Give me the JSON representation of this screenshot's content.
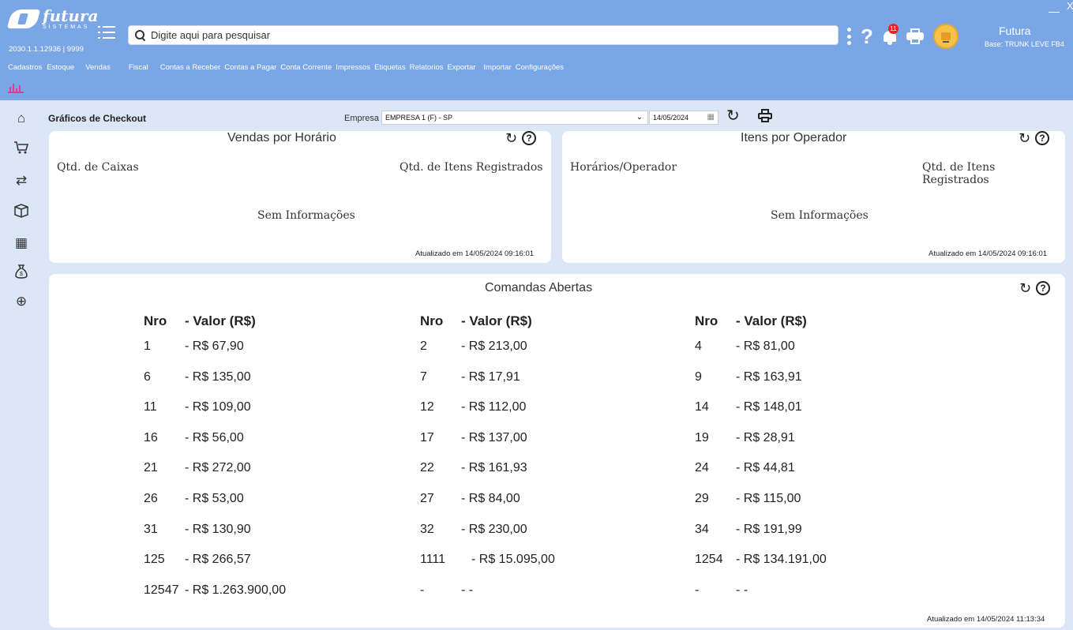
{
  "app": {
    "logo_brand": "futura",
    "logo_sub": "SISTEMAS",
    "version": "2030.1.1.12936 | 9999",
    "search_placeholder": "Digite aqui para pesquisar",
    "notification_count": "11",
    "user_name": "Futura",
    "user_base": "Base: TRUNK LEVE FB4",
    "window_min": "—",
    "window_close": "X"
  },
  "nav": [
    "Cadastros",
    "Estoque",
    "Vendas",
    "Fiscal",
    "Contas a Receber",
    "Contas a Pagar",
    "Conta Corrente",
    "Impressos",
    "Etiquetas",
    "Relatorios",
    "Exportar",
    "Importar",
    "Configurações"
  ],
  "sidebar": [
    {
      "name": "dashboard-icon",
      "glyph": "⌂"
    },
    {
      "name": "cart-icon",
      "glyph": "🛒"
    },
    {
      "name": "chart-people-icon",
      "glyph": "⇄"
    },
    {
      "name": "box-icon",
      "glyph": "▭"
    },
    {
      "name": "cash-register-icon",
      "glyph": "▦"
    },
    {
      "name": "money-bag-icon",
      "glyph": "$"
    },
    {
      "name": "globe-icon",
      "glyph": "⊕"
    }
  ],
  "page": {
    "title": "Gráficos de Checkout",
    "empresa_label": "Empresa",
    "empresa_value": "EMPRESA 1 (F) - SP",
    "date_value": "14/05/2024"
  },
  "vendas_horario": {
    "title": "Vendas por Horário",
    "col_left": "Qtd. de Caixas",
    "col_right": "Qtd. de Itens Registrados",
    "empty": "Sem Informações",
    "updated": "Atualizado em 14/05/2024 09:16:01"
  },
  "itens_operador": {
    "title": "Itens por Operador",
    "col_left": "Horários/Operador",
    "col_right": "Qtd. de Itens Registrados",
    "empty": "Sem Informações",
    "updated": "Atualizado em 14/05/2024 09:16:01"
  },
  "comandas": {
    "title": "Comandas Abertas",
    "head_nro": "Nro",
    "head_valor": "- Valor (R$)",
    "updated": "Atualizado em 14/05/2024 11:13:34",
    "columns": [
      [
        {
          "nro": "1",
          "valor": "- R$ 67,90"
        },
        {
          "nro": "6",
          "valor": "- R$ 135,00"
        },
        {
          "nro": "11",
          "valor": "- R$ 109,00"
        },
        {
          "nro": "16",
          "valor": "- R$ 56,00"
        },
        {
          "nro": "21",
          "valor": "- R$ 272,00"
        },
        {
          "nro": "26",
          "valor": "- R$ 53,00"
        },
        {
          "nro": "31",
          "valor": "- R$ 130,90"
        },
        {
          "nro": "125",
          "valor": "- R$ 266,57"
        },
        {
          "nro": "12547",
          "valor": "- R$ 1.263.900,00"
        }
      ],
      [
        {
          "nro": "2",
          "valor": "- R$ 213,00"
        },
        {
          "nro": "7",
          "valor": "- R$ 17,91"
        },
        {
          "nro": "12",
          "valor": "- R$ 112,00"
        },
        {
          "nro": "17",
          "valor": "- R$ 137,00"
        },
        {
          "nro": "22",
          "valor": "- R$ 161,93"
        },
        {
          "nro": "27",
          "valor": "- R$ 84,00"
        },
        {
          "nro": "32",
          "valor": "- R$ 230,00"
        },
        {
          "nro": "1111",
          "valor": "- R$ 15.095,00"
        },
        {
          "nro": "-",
          "valor": "- -"
        }
      ],
      [
        {
          "nro": "4",
          "valor": "- R$ 81,00"
        },
        {
          "nro": "9",
          "valor": "- R$ 163,91"
        },
        {
          "nro": "14",
          "valor": "- R$ 148,01"
        },
        {
          "nro": "19",
          "valor": "- R$ 28,91"
        },
        {
          "nro": "24",
          "valor": "- R$ 44,81"
        },
        {
          "nro": "29",
          "valor": "- R$ 115,00"
        },
        {
          "nro": "34",
          "valor": "- R$ 191,99"
        },
        {
          "nro": "1254",
          "valor": "- R$ 134.191,00"
        },
        {
          "nro": "-",
          "valor": "- -"
        }
      ]
    ]
  }
}
